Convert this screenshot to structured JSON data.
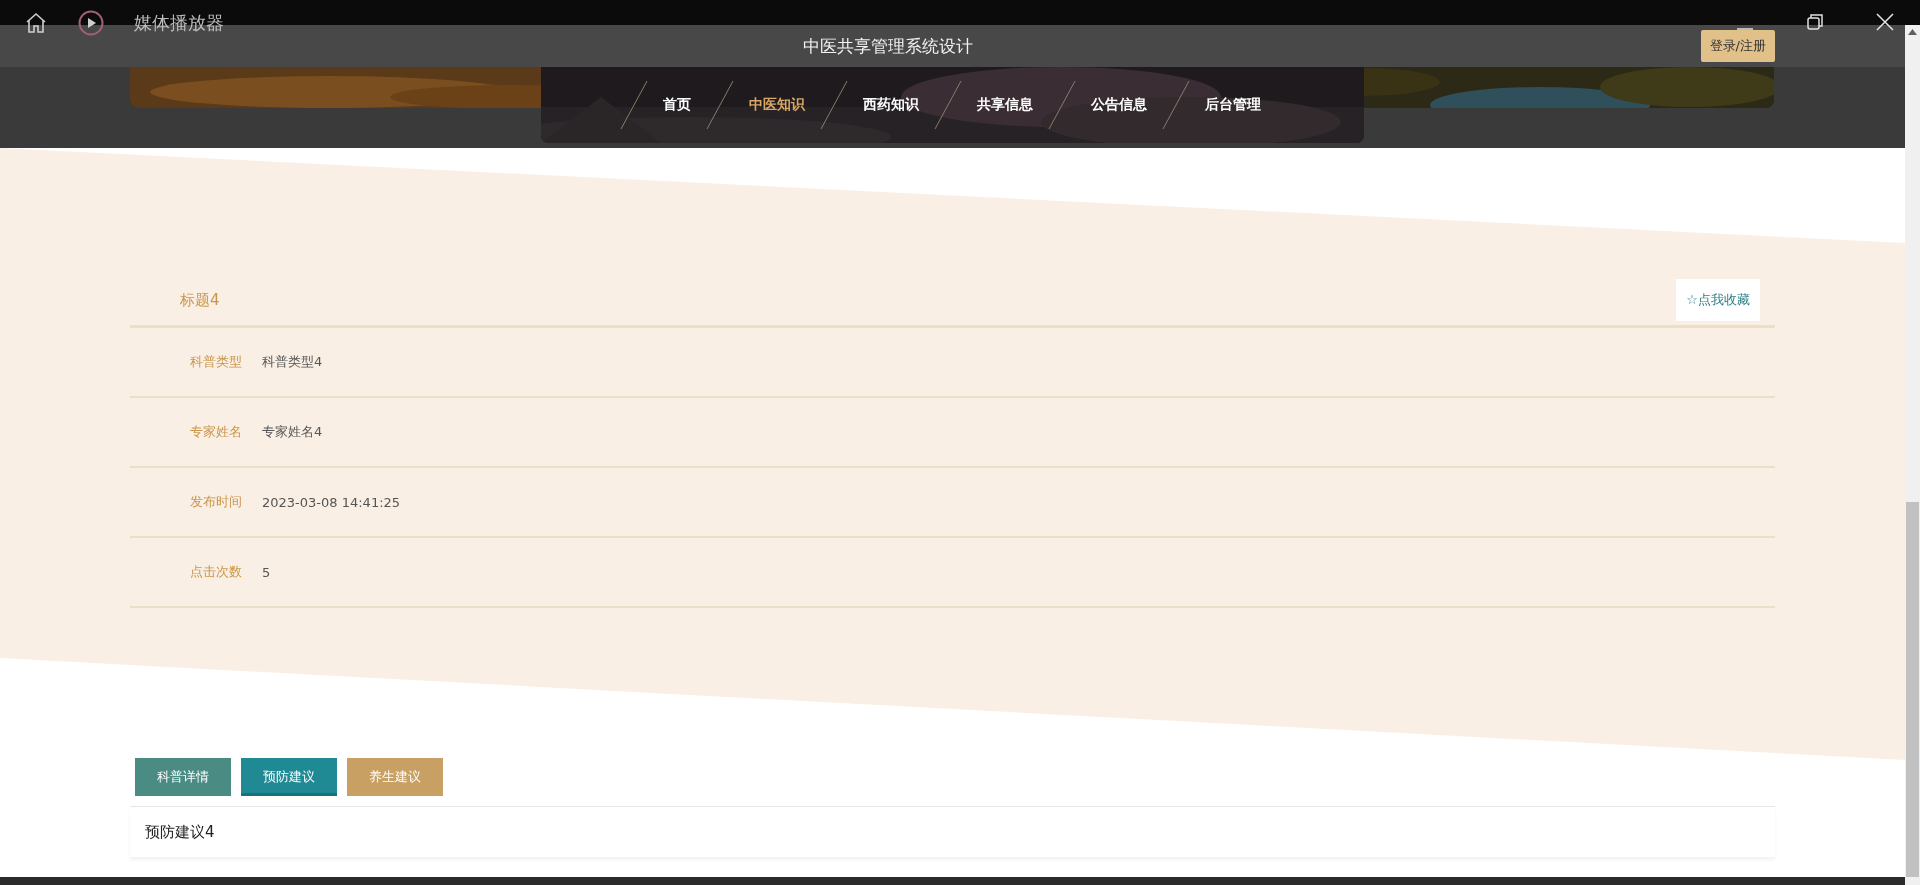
{
  "media_player": {
    "title": "媒体播放器"
  },
  "site": {
    "title": "中医共享管理系统设计",
    "login_button": "登录/注册"
  },
  "nav": [
    {
      "label": "首页",
      "selected": false
    },
    {
      "label": "中医知识",
      "selected": true
    },
    {
      "label": "西药知识",
      "selected": false
    },
    {
      "label": "共享信息",
      "selected": false
    },
    {
      "label": "公告信息",
      "selected": false
    },
    {
      "label": "后台管理",
      "selected": false
    }
  ],
  "detail": {
    "title": "标题4",
    "favorite_button": "☆点我收藏",
    "fields": [
      {
        "label": "科普类型",
        "value": "科普类型4"
      },
      {
        "label": "专家姓名",
        "value": "专家姓名4"
      },
      {
        "label": "发布时间",
        "value": "2023-03-08 14:41:25"
      },
      {
        "label": "点击次数",
        "value": "5"
      }
    ]
  },
  "tabs": [
    {
      "label": "科普详情",
      "selected": false,
      "color": "#4a8c84"
    },
    {
      "label": "预防建议",
      "selected": true,
      "color": "#1f8a94"
    },
    {
      "label": "养生建议",
      "selected": false,
      "color": "#c9a063"
    }
  ],
  "tab_content": "预防建议4"
}
